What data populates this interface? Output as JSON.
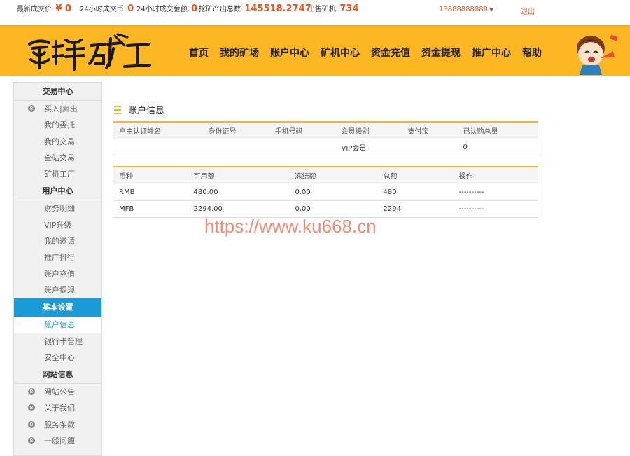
{
  "topbar": {
    "stats": [
      {
        "label": "最新成交价:",
        "value": "¥ 0"
      },
      {
        "label": "24小时成交币:",
        "value": "0"
      },
      {
        "label": "24小时成交金额:",
        "value": "0"
      },
      {
        "label": "挖矿产出总数:",
        "value": "145518.2747"
      },
      {
        "label": "出售矿机:",
        "value": "734"
      }
    ],
    "user": "13888888888",
    "logout": "退出"
  },
  "header": {
    "logo_text": "蜜蜂矿工",
    "nav": [
      "首页",
      "我的矿场",
      "账户中心",
      "矿机中心",
      "资金充值",
      "资金提现",
      "推广中心",
      "帮助"
    ]
  },
  "sidebar": {
    "sections": [
      {
        "title": "交易中心",
        "items": [
          "买入|卖出",
          "我的委托",
          "我的交易",
          "全站交易",
          "矿机工厂"
        ]
      },
      {
        "title": "用户中心",
        "items": [
          "财务明细",
          "VIP升级",
          "我的邀请",
          "推广排行",
          "账户充值",
          "账户提现"
        ]
      },
      {
        "title": "基本设置",
        "items": [
          "账户信息",
          "银行卡管理",
          "安全中心"
        ]
      },
      {
        "title": "网站信息",
        "items": [
          "网站公告",
          "关于我们",
          "服务条款",
          "一般问题"
        ]
      }
    ]
  },
  "main": {
    "title": "账户信息",
    "account_table": {
      "headers": [
        "户主认证姓名",
        "身份证号",
        "手机号码",
        "会员级别",
        "支付宝",
        "已认购总量"
      ],
      "row": [
        "",
        "",
        "",
        "VIP会员",
        "",
        "0"
      ]
    },
    "balance_table": {
      "headers": [
        "币种",
        "可用额",
        "冻结额",
        "总额",
        "操作"
      ],
      "rows": [
        [
          "RMB",
          "480.00",
          "0.00",
          "480",
          "----------"
        ],
        [
          "MFB",
          "2294.00",
          "0.00",
          "2294",
          "----------"
        ]
      ]
    }
  },
  "watermark": "https://www.ku668.cn",
  "colors": {
    "accent": "#fcb722",
    "active": "#1a9ad6",
    "highlight": "#e8531d"
  }
}
